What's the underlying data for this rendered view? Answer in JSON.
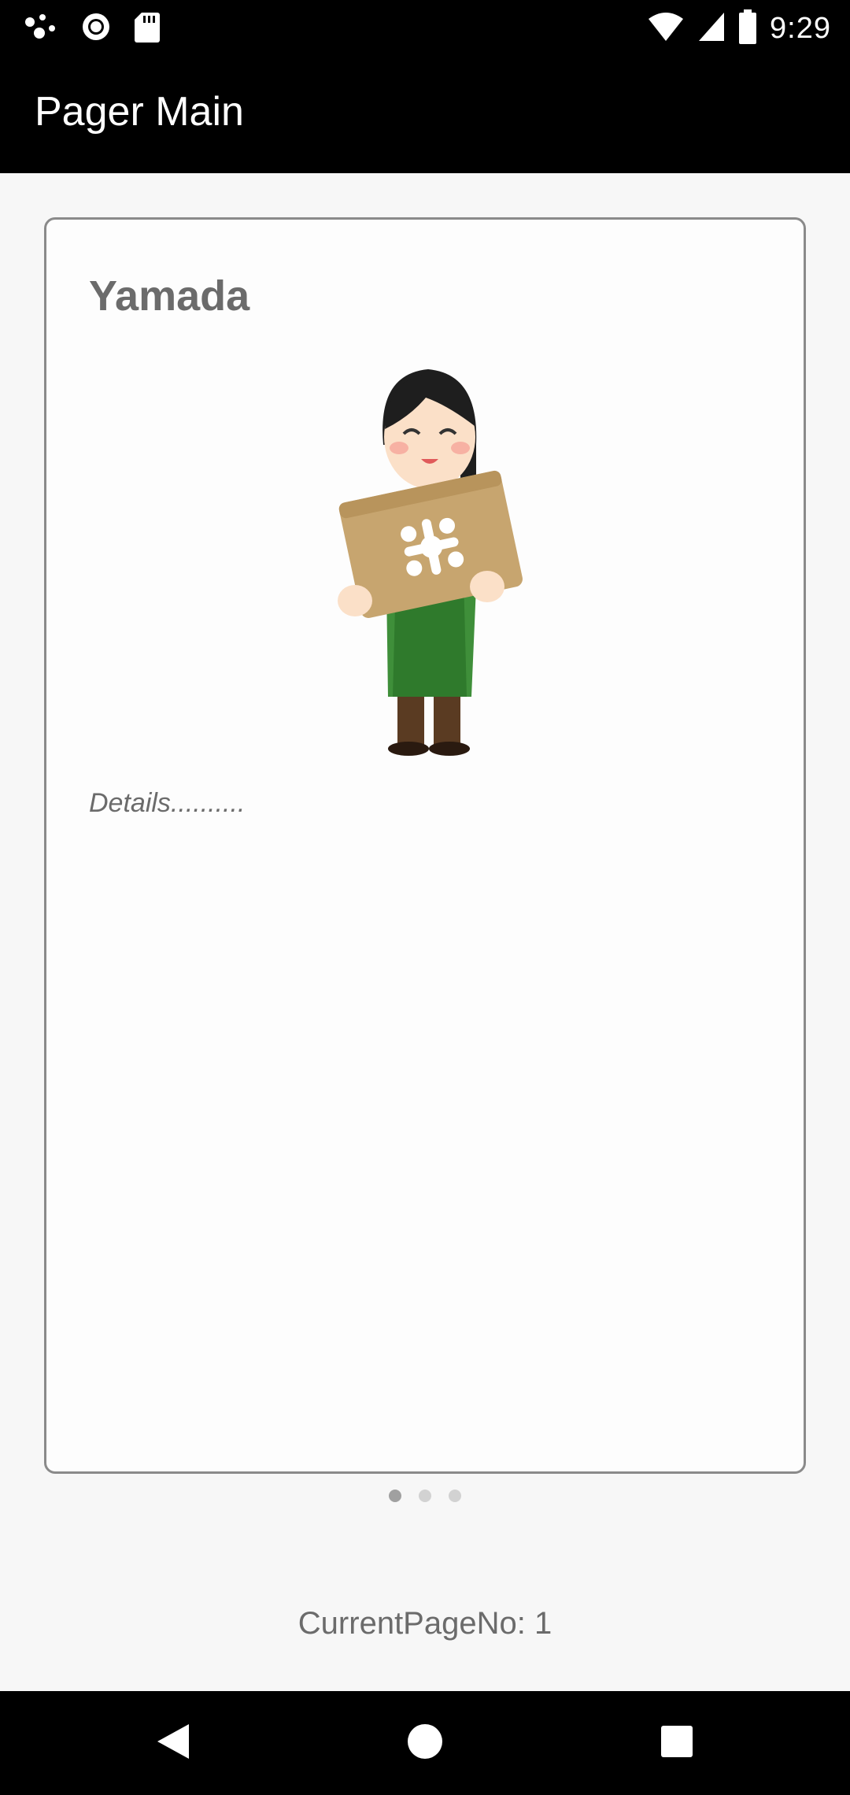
{
  "status_bar": {
    "time": "9:29",
    "icons": [
      "assistant-dots-icon",
      "record-icon",
      "sd-card-icon",
      "wifi-icon",
      "signal-icon",
      "battery-icon"
    ]
  },
  "app_bar": {
    "title": "Pager Main"
  },
  "pager": {
    "page_count": 3,
    "current_index": 0,
    "card": {
      "name": "Yamada",
      "details": "Details..........",
      "illustration": "person-holding-box"
    }
  },
  "footer": {
    "current_page_text": "CurrentPageNo: 1"
  },
  "nav_bar": {
    "buttons": [
      "back-icon",
      "home-icon",
      "recents-icon"
    ]
  },
  "colors": {
    "bar_background": "#000000",
    "card_border": "#8a8a8a",
    "text_gray": "#6b6b6b",
    "dot_active": "#a0a0a0",
    "dot_inactive": "#d2d2d2"
  }
}
